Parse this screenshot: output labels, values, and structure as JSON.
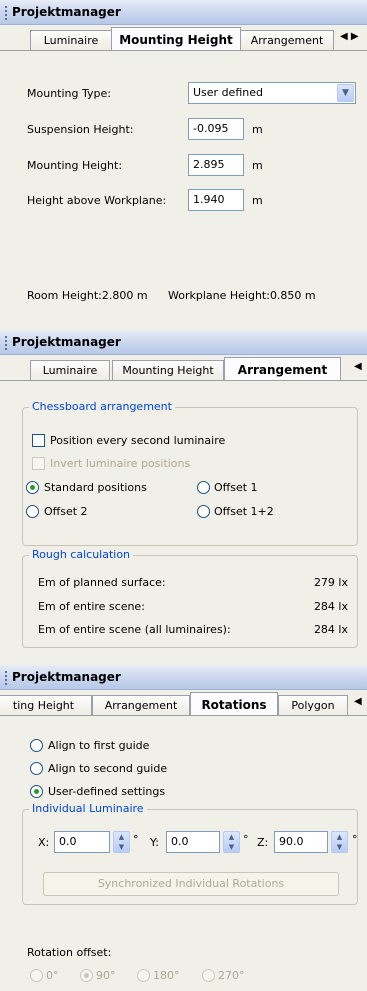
{
  "panel1": {
    "title": "Projektmanager",
    "tabs": [
      "Luminaire",
      "Mounting Height",
      "Arrangement"
    ],
    "active_tab": "Mounting Height",
    "tab_scroll": "◀ ▶",
    "mounting_type_label": "Mounting Type:",
    "mounting_type_value": "User defined",
    "suspension_label": "Suspension Height:",
    "suspension_value": "-0.095",
    "mounting_height_label": "Mounting Height:",
    "mounting_height_value": "2.895",
    "workplane_label": "Height above Workplane:",
    "workplane_value": "1.940",
    "unit": "m",
    "room_height": "Room Height:2.800 m",
    "workplane_height": "Workplane Height:0.850 m"
  },
  "panel2": {
    "title": "Projektmanager",
    "tabs": [
      "Luminaire",
      "Mounting Height",
      "Arrangement"
    ],
    "active_tab": "Arrangement",
    "tab_scroll": "◀",
    "chess_group": "Chessboard arrangement",
    "position_every_second": "Position every second luminaire",
    "invert_positions": "Invert luminaire positions",
    "standard_positions": "Standard positions",
    "offset1": "Offset 1",
    "offset2": "Offset 2",
    "offset12": "Offset 1+2",
    "rough_group": "Rough calculation",
    "rows": [
      {
        "label": "Em of planned surface:",
        "value": "279 lx"
      },
      {
        "label": "Em of entire scene:",
        "value": "284 lx"
      },
      {
        "label": "Em of entire scene (all luminaires):",
        "value": "284 lx"
      }
    ]
  },
  "panel3": {
    "title": "Projektmanager",
    "tabs": [
      "ting Height",
      "Arrangement",
      "Rotations",
      "Polygon"
    ],
    "active_tab": "Rotations",
    "tab_scroll": "◀",
    "align_first": "Align to first guide",
    "align_second": "Align to second guide",
    "user_defined": "User-defined settings",
    "individual_group": "Individual Luminaire",
    "x_label": "X:",
    "x_value": "0.0",
    "y_label": "Y:",
    "y_value": "0.0",
    "z_label": "Z:",
    "z_value": "90.0",
    "degree": "°",
    "sync_button": "Synchronized Individual Rotations",
    "rotation_offset_label": "Rotation offset:",
    "offsets": [
      "0°",
      "90°",
      "180°",
      "270°"
    ],
    "selected_offset": "90°"
  }
}
